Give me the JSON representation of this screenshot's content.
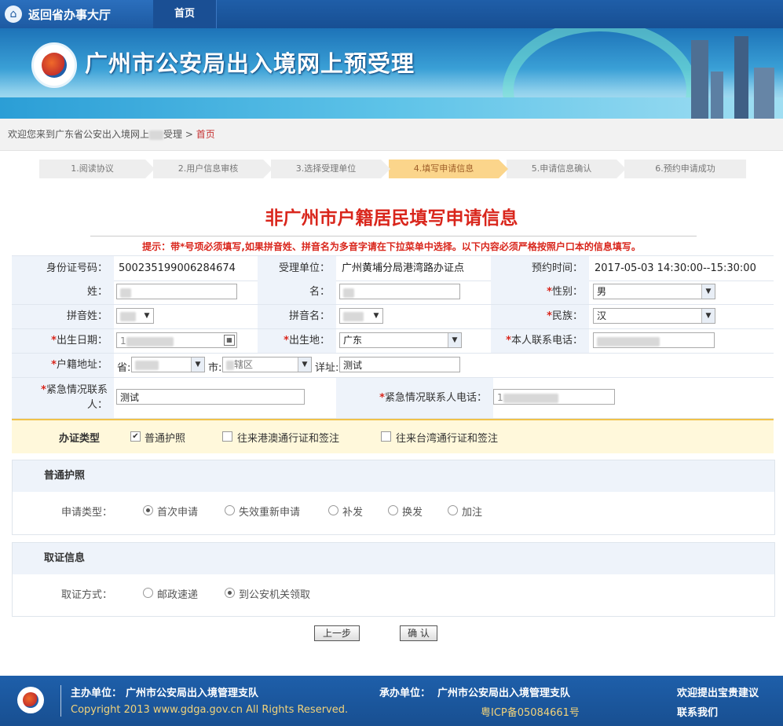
{
  "topbar": {
    "back_label": "返回省办事大厅",
    "home_tab": "首页"
  },
  "banner": {
    "title": "广州市公安局出入境网上预受理"
  },
  "breadcrumb": {
    "prefix": "欢迎您来到广东省公安出入境网上",
    "suffix": "受理",
    "sep": ">",
    "current": "首页"
  },
  "steps": [
    "1.阅读协议",
    "2.用户信息审核",
    "3.选择受理单位",
    "4.填写申请信息",
    "5.申请信息确认",
    "6.预约申请成功"
  ],
  "active_step": 3,
  "form": {
    "title": "非广州市户籍居民填写申请信息",
    "tip": "提示：带*号项必须填写,如果拼音姓、拼音名为多音字请在下拉菜单中选择。以下内容必须严格按照户口本的信息填写。",
    "id_label": "身份证号码：",
    "id_value": "500235199006284674",
    "unit_label": "受理单位：",
    "unit_value": "广州黄埔分局港湾路办证点",
    "time_label": "预约时间：",
    "time_value": "2017-05-03  14:30:00--15:30:00",
    "surname_label": "姓：",
    "name_label": "名：",
    "gender_label": "性别：",
    "gender_value": "男",
    "py_surname_label": "拼音姓：",
    "py_name_label": "拼音名：",
    "ethnic_label": "民族：",
    "ethnic_value": "汉",
    "birth_label": "出生日期：",
    "birth_value": "1",
    "birthplace_label": "出生地：",
    "birthplace_value": "广东",
    "phone_label": "本人联系电话：",
    "huji_label": "户籍地址：",
    "prov_label": "省:",
    "city_label": "市:",
    "city_value": "辖区",
    "detail_label": "详址:",
    "detail_value": "测试",
    "emerg_label": "紧急情况联系人：",
    "emerg_value": "测试",
    "emerg_phone_label": "紧急情况联系人电话：",
    "emerg_phone_value": "1",
    "star": "*"
  },
  "doc_type": {
    "label": "办证类型",
    "options": [
      "普通护照",
      "往来港澳通行证和签注",
      "往来台湾通行证和签注"
    ],
    "checked": [
      true,
      false,
      false
    ]
  },
  "passport": {
    "header": "普通护照",
    "apply_label": "申请类型：",
    "options": [
      "首次申请",
      "失效重新申请",
      "补发",
      "换发",
      "加注"
    ],
    "selected": 0
  },
  "pickup": {
    "header": "取证信息",
    "method_label": "取证方式：",
    "options": [
      "邮政速递",
      "到公安机关领取"
    ],
    "selected": 1
  },
  "buttons": {
    "prev": "上一步",
    "confirm": "确 认"
  },
  "footer": {
    "host_label": "主办单位：",
    "host_value": "广州市公安局出入境管理支队",
    "org_label": "承办单位：",
    "org_value": "广州市公安局出入境管理支队",
    "suggest": "欢迎提出宝贵建议",
    "copyright": "Copyright 2013 www.gdga.gov.cn All Rights Reserved.",
    "icp": "粤ICP备05084661号",
    "contact": "联系我们"
  }
}
